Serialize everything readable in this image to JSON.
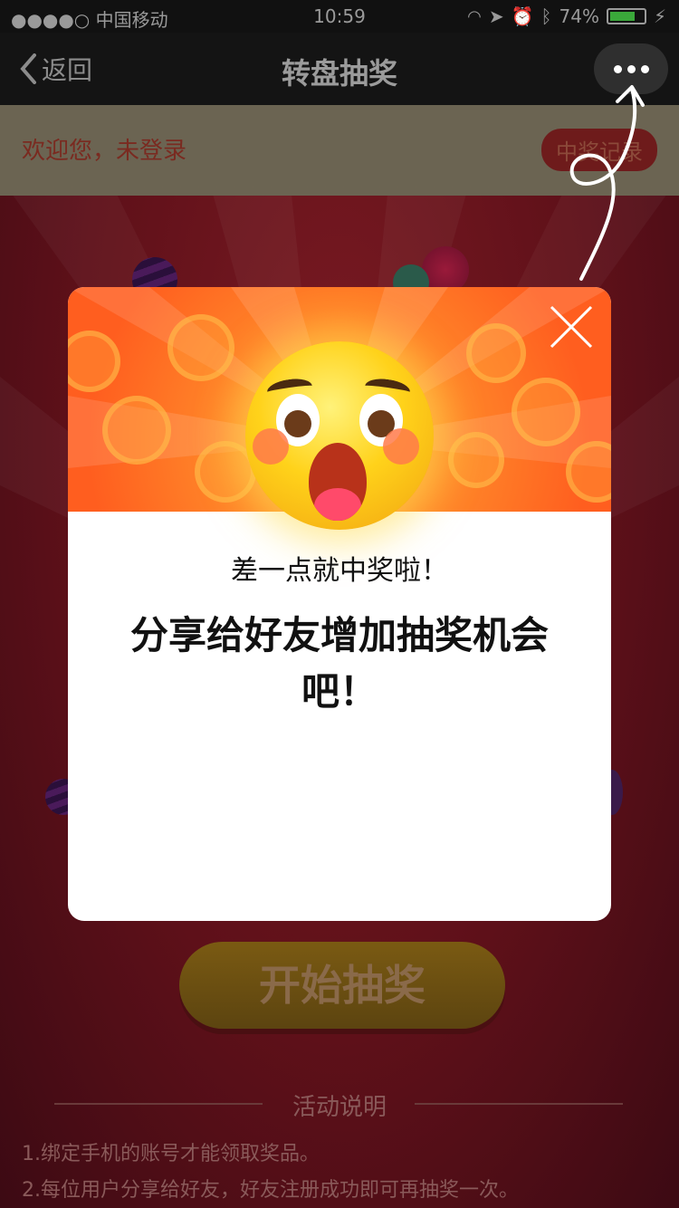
{
  "status_bar": {
    "carrier": "●●●●○ 中国移动",
    "time": "10:59",
    "battery_pct": "74%",
    "battery_level": 0.74
  },
  "nav": {
    "back_label": "返回",
    "title": "转盘抽奖"
  },
  "page": {
    "welcome_text": "欢迎您，未登录",
    "records_button": "中奖记录",
    "start_button": "开始抽奖",
    "rules_title": "活动说明",
    "rules": [
      "1.绑定手机的账号才能领取奖品。",
      "2.每位用户分享给好友，好友注册成功即可再抽奖一次。"
    ]
  },
  "modal": {
    "headline": "差一点就中奖啦！",
    "message": "分享给好友增加抽奖机会吧！"
  },
  "colors": {
    "modal_header": "#ff5e1f",
    "page_background": "#5e1019",
    "start_button": "#7a5a12"
  }
}
